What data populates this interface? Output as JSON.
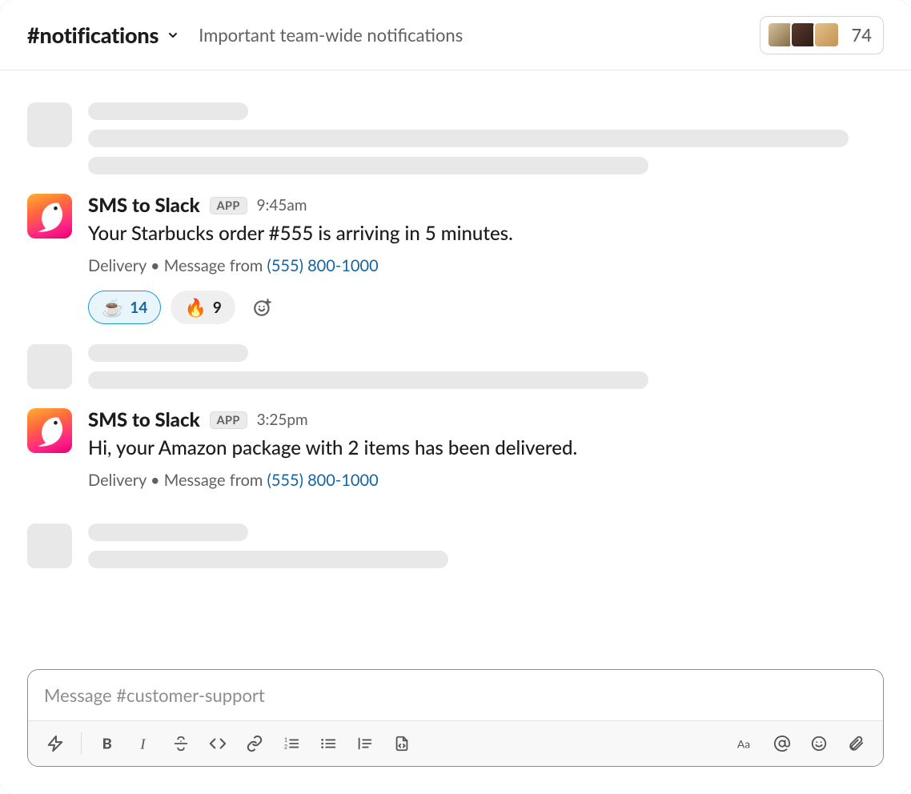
{
  "header": {
    "channel_name": "#notifications",
    "subtitle": "Important team-wide notifications",
    "members_count": "74"
  },
  "messages": {
    "msg1": {
      "sender": "SMS to Slack",
      "app_badge": "APP",
      "time": "9:45am",
      "text": "Your Starbucks order #555 is arriving in 5 minutes.",
      "context_pre": "Delivery • Message from ",
      "context_link": "(555) 800-1000",
      "reaction1_emoji": "☕",
      "reaction1_count": "14",
      "reaction2_emoji": "🔥",
      "reaction2_count": "9"
    },
    "msg2": {
      "sender": "SMS to Slack",
      "app_badge": "APP",
      "time": "3:25pm",
      "text": "Hi, your Amazon package with 2 items has been delivered.",
      "context_pre": "Delivery • Message from ",
      "context_link": "(555) 800-1000"
    }
  },
  "composer": {
    "placeholder": "Message #customer-support"
  }
}
